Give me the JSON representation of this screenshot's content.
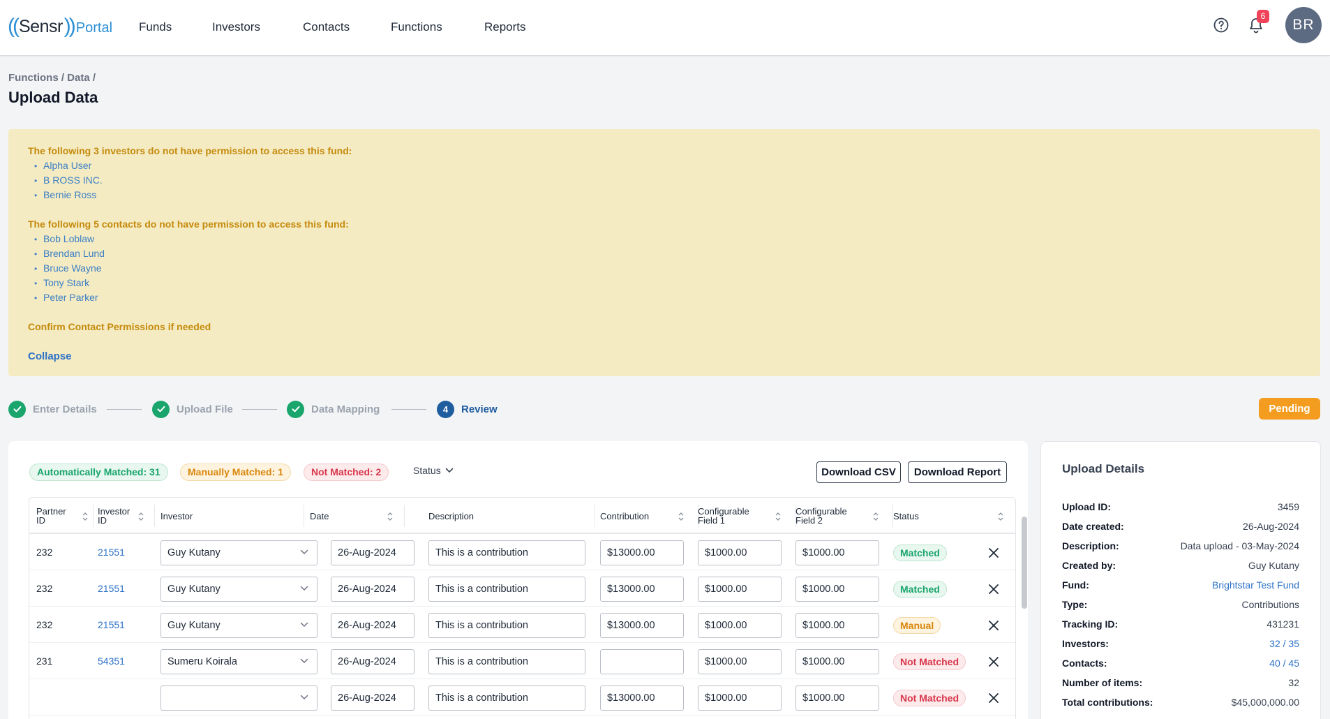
{
  "app": {
    "logo_brand": "Sensr",
    "logo_suffix": "Portal",
    "notification_count": "6",
    "avatar_initials": "BR"
  },
  "nav": {
    "items": [
      "Funds",
      "Investors",
      "Contacts",
      "Functions",
      "Reports"
    ]
  },
  "page": {
    "breadcrumb": "Functions / Data /",
    "title": "Upload Data"
  },
  "warning": {
    "investors_heading": "The following 3 investors do not have permission to access this fund:",
    "investors": [
      "Alpha User",
      "B ROSS INC.",
      "Bernie Ross"
    ],
    "contacts_heading": "The following 5 contacts do not have permission to access this fund:",
    "contacts": [
      "Bob Loblaw",
      "Brendan Lund",
      "Bruce Wayne",
      "Tony Stark",
      "Peter Parker"
    ],
    "confirm_text": "Confirm Contact Permissions if needed",
    "collapse_label": "Collapse",
    "heading_color": "#c58a0c",
    "background_color": "#f4ebc3"
  },
  "stepper": {
    "steps": [
      {
        "label": "Enter Details",
        "state": "done"
      },
      {
        "label": "Upload File",
        "state": "done"
      },
      {
        "label": "Data Mapping",
        "state": "done"
      },
      {
        "label": "Review",
        "state": "active",
        "number": "4"
      }
    ],
    "status_label": "Pending",
    "status_color": "#f39c1f"
  },
  "summary": {
    "auto_matched": "Automatically Matched: 31",
    "manually_matched": "Manually Matched: 1",
    "not_matched": "Not Matched: 2",
    "status_filter_label": "Status",
    "download_csv_label": "Download CSV",
    "download_report_label": "Download Report"
  },
  "table": {
    "columns": {
      "partner_id": [
        "Partner",
        "ID"
      ],
      "investor_id": [
        "Investor",
        "ID"
      ],
      "investor": "Investor",
      "date": "Date",
      "description": "Description",
      "contribution": "Contribution",
      "field1": [
        "Configurable",
        "Field 1"
      ],
      "field2": [
        "Configurable",
        "Field 2"
      ],
      "status": "Status"
    },
    "rows": [
      {
        "partner_id": "232",
        "investor_id": "21551",
        "investor": "Guy Kutany",
        "date": "26-Aug-2024",
        "description": "This is a contribution",
        "contribution": "$13000.00",
        "field1": "$1000.00",
        "field2": "$1000.00",
        "status": "Matched",
        "status_type": "matched"
      },
      {
        "partner_id": "232",
        "investor_id": "21551",
        "investor": "Guy Kutany",
        "date": "26-Aug-2024",
        "description": "This is a contribution",
        "contribution": "$13000.00",
        "field1": "$1000.00",
        "field2": "$1000.00",
        "status": "Matched",
        "status_type": "matched"
      },
      {
        "partner_id": "232",
        "investor_id": "21551",
        "investor": "Guy Kutany",
        "date": "26-Aug-2024",
        "description": "This is a contribution",
        "contribution": "$13000.00",
        "field1": "$1000.00",
        "field2": "$1000.00",
        "status": "Manual",
        "status_type": "manual"
      },
      {
        "partner_id": "231",
        "investor_id": "54351",
        "investor": "Sumeru Koirala",
        "date": "26-Aug-2024",
        "description": "This is a contribution",
        "contribution": "",
        "field1": "$1000.00",
        "field2": "$1000.00",
        "status": "Not Matched",
        "status_type": "notmatched"
      },
      {
        "partner_id": "",
        "investor_id": "",
        "investor": "",
        "date": "26-Aug-2024",
        "description": "This is a contribution",
        "contribution": "$13000.00",
        "field1": "$1000.00",
        "field2": "$1000.00",
        "status": "Not Matched",
        "status_type": "notmatched"
      }
    ]
  },
  "upload_details": {
    "title": "Upload Details",
    "items": [
      {
        "label": "Upload ID:",
        "value": "3459",
        "link": false
      },
      {
        "label": "Date created:",
        "value": "26-Aug-2024",
        "link": false
      },
      {
        "label": "Description:",
        "value": "Data upload - 03-May-2024",
        "link": false
      },
      {
        "label": "Created by:",
        "value": "Guy Kutany",
        "link": false
      },
      {
        "label": "Fund:",
        "value": "Brightstar Test Fund",
        "link": true
      },
      {
        "label": "Type:",
        "value": "Contributions",
        "link": false
      },
      {
        "label": "Tracking ID:",
        "value": "431231",
        "link": false
      },
      {
        "label": "Investors:",
        "value": "32 / 35",
        "link": true
      },
      {
        "label": "Contacts:",
        "value": "40 / 45",
        "link": true
      },
      {
        "label": "Number of items:",
        "value": "32",
        "link": false
      },
      {
        "label": "Total contributions:",
        "value": "$45,000,000.00",
        "link": false
      }
    ]
  },
  "colors": {
    "accent_blue": "#2d72c7",
    "success_green": "#1aa56d",
    "warning_orange": "#d9870c",
    "danger_red": "#d8364c"
  },
  "icons": {
    "help": "help-circle-icon",
    "notifications": "bell-icon",
    "step_done": "check-icon",
    "dropdown": "chevron-down-icon",
    "sort": "sort-icon",
    "remove_row": "close-icon"
  }
}
